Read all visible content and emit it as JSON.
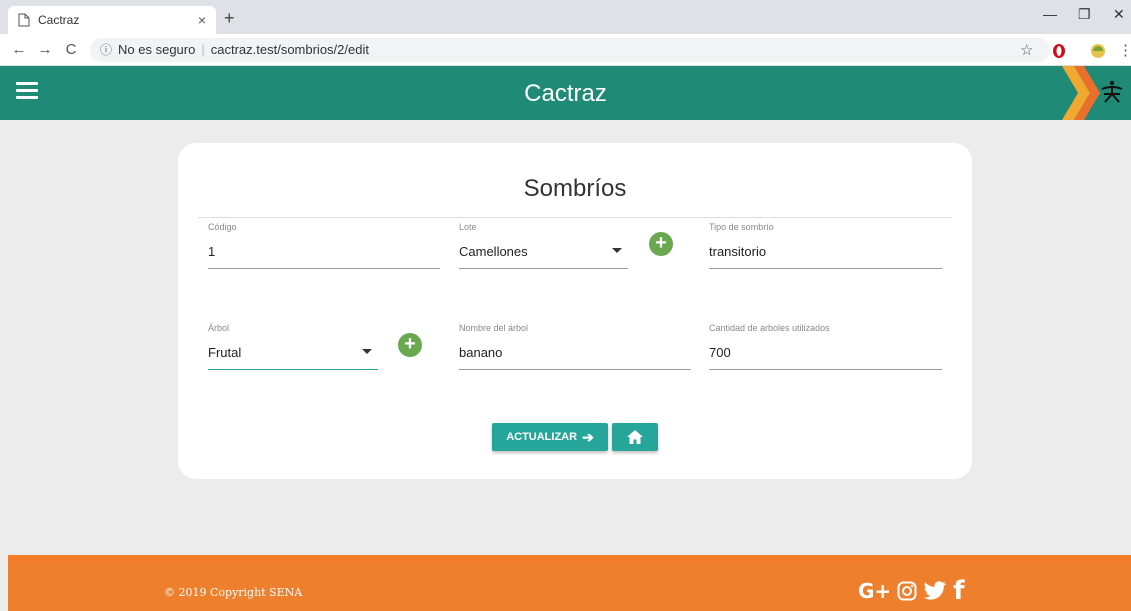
{
  "browser": {
    "tab_title": "Cactraz",
    "tab_close": "×",
    "new_tab": "+",
    "nav_back": "←",
    "nav_forward": "→",
    "nav_reload": "C",
    "security_label": "No es seguro",
    "url": "cactraz.test/sombrios/2/edit",
    "star": "☆"
  },
  "header": {
    "title": "Cactraz",
    "color": "#1f8a76"
  },
  "form": {
    "title": "Sombríos",
    "codigo": {
      "label": "Código",
      "value": "1"
    },
    "lote": {
      "label": "Lote",
      "value": "Camellones"
    },
    "tipo": {
      "label": "Tipo de sombrío",
      "value": "transitorio"
    },
    "arbol": {
      "label": "Árbol",
      "value": "Frutal"
    },
    "nombre_arbol": {
      "label": "Nombre del árbol",
      "value": "banano"
    },
    "cantidad": {
      "label": "Cantidad de arboles utilizados",
      "value": "700"
    },
    "update_label": "ACTUALIZAR",
    "accent": "#26a69a",
    "add_color": "#6aa84f"
  },
  "footer": {
    "copyright": "© 2019 Copyright SENA",
    "gplus": "G+",
    "facebook": "f",
    "color": "#ee7f2c"
  }
}
